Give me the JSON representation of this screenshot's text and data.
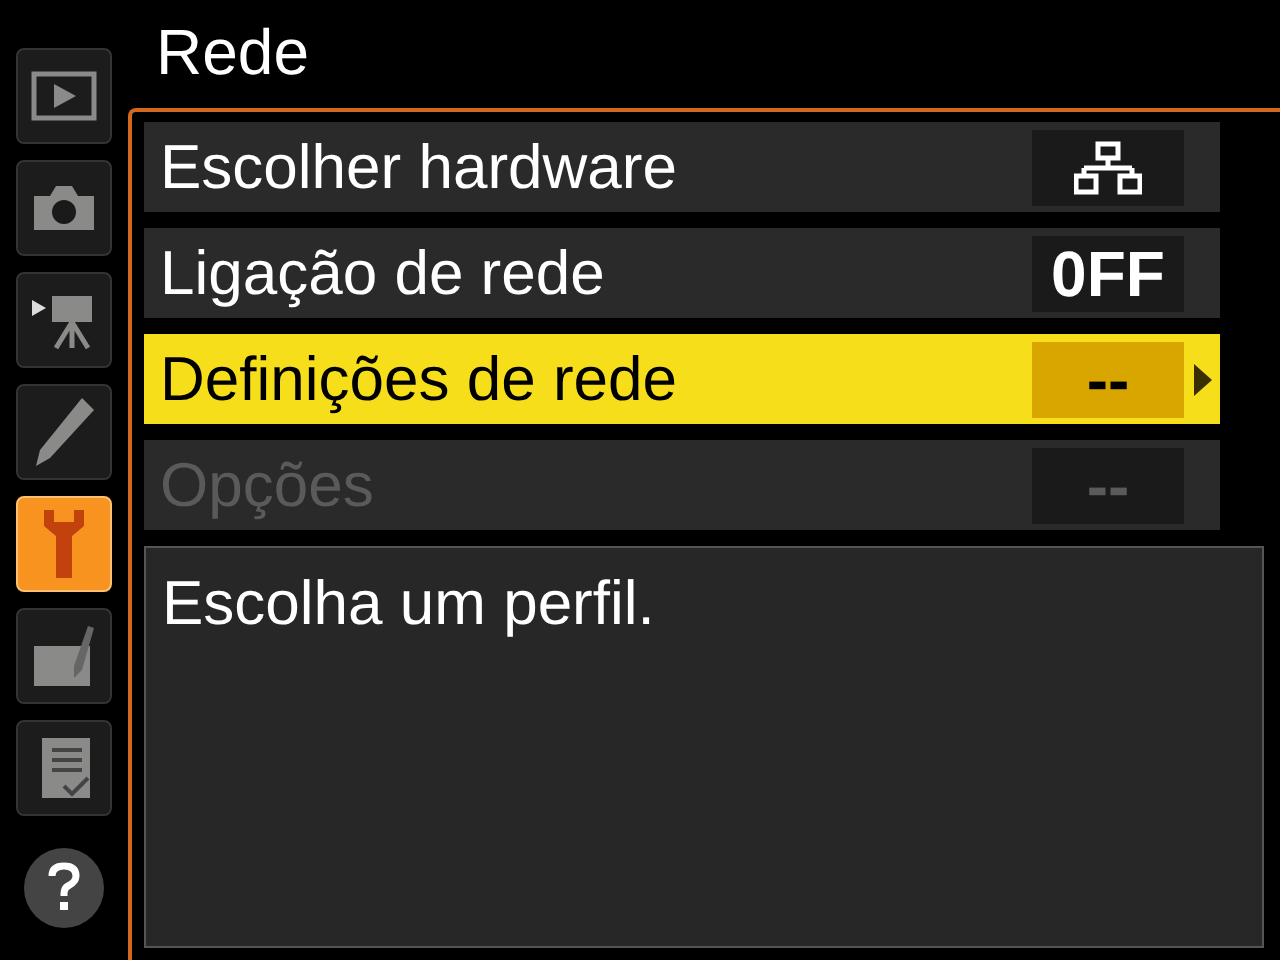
{
  "title": "Rede",
  "sidebar": [
    {
      "kind": "playback",
      "selected": false
    },
    {
      "kind": "camera",
      "selected": false
    },
    {
      "kind": "movie",
      "selected": false
    },
    {
      "kind": "pencil",
      "selected": false
    },
    {
      "kind": "wrench",
      "selected": true
    },
    {
      "kind": "retouch",
      "selected": false
    },
    {
      "kind": "checklist",
      "selected": false
    },
    {
      "kind": "help",
      "selected": false
    }
  ],
  "menu": [
    {
      "label": "Escolher hardware",
      "kind": "network",
      "selected": false,
      "disabled": false
    },
    {
      "label": "Ligação de rede",
      "kind": "text",
      "value": "0FF",
      "selected": false,
      "disabled": false
    },
    {
      "label": "Definições de rede",
      "kind": "text",
      "value": "--",
      "selected": true,
      "disabled": false
    },
    {
      "label": "Opções",
      "kind": "text",
      "value": "--",
      "selected": false,
      "disabled": true
    }
  ],
  "help_text": "Escolha um perfil."
}
